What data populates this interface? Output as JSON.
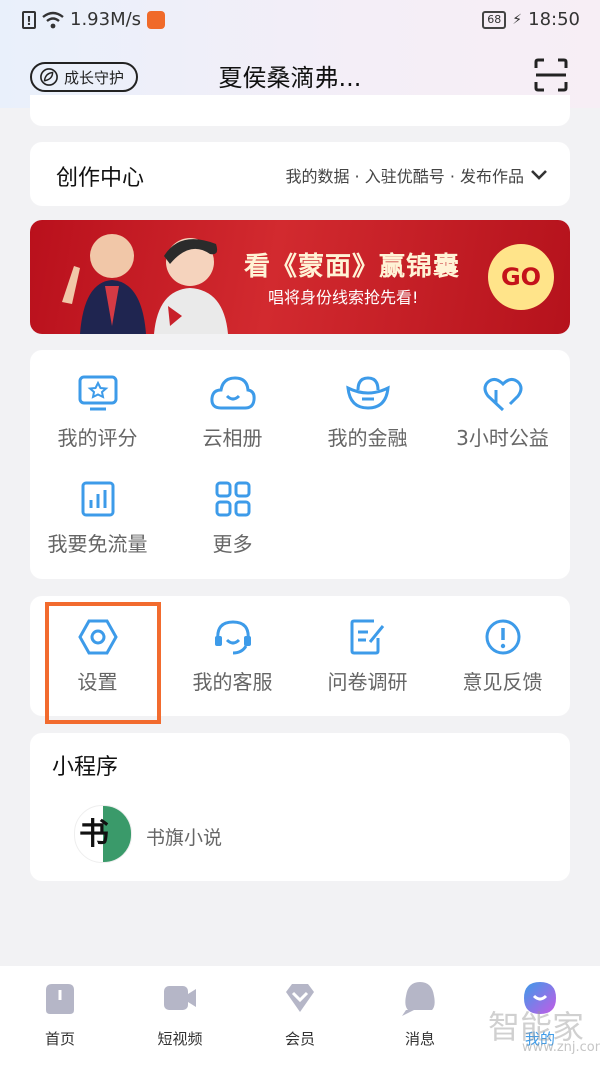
{
  "status_bar": {
    "speed": "1.93M/s",
    "battery": "68",
    "time": "18:50"
  },
  "header": {
    "guard_label": "成长守护",
    "title": "夏侯桑滴弗..."
  },
  "creation": {
    "label": "创作中心",
    "links": "我的数据 · 入驻优酷号 · 发布作品"
  },
  "banner": {
    "headline": "看《蒙面》赢锦囊",
    "sub": "唱将身份线索抢先看!",
    "go": "GO"
  },
  "services": [
    {
      "label": "我的评分",
      "icon": "rating-icon"
    },
    {
      "label": "云相册",
      "icon": "cloud-icon"
    },
    {
      "label": "我的金融",
      "icon": "ingot-icon"
    },
    {
      "label": "3小时公益",
      "icon": "charity-icon"
    },
    {
      "label": "我要免流量",
      "icon": "data-chart-icon"
    },
    {
      "label": "更多",
      "icon": "grid-icon"
    }
  ],
  "tools": [
    {
      "label": "设置",
      "icon": "settings-icon"
    },
    {
      "label": "我的客服",
      "icon": "customer-service-icon"
    },
    {
      "label": "问卷调研",
      "icon": "survey-icon"
    },
    {
      "label": "意见反馈",
      "icon": "feedback-icon"
    }
  ],
  "mini_programs": {
    "label": "小程序",
    "items": [
      {
        "name": "书旗小说",
        "logo_text": "书"
      }
    ]
  },
  "tabs": [
    {
      "label": "首页",
      "icon": "home-icon"
    },
    {
      "label": "短视频",
      "icon": "video-icon"
    },
    {
      "label": "会员",
      "icon": "vip-icon"
    },
    {
      "label": "消息",
      "icon": "message-icon"
    },
    {
      "label": "我的",
      "icon": "profile-icon",
      "active": true
    }
  ],
  "watermark": {
    "main": "智能家",
    "site": "www.znj.com"
  },
  "colors": {
    "accent": "#3d9be9",
    "highlight_box": "#f26b2e",
    "banner": "#c41b22"
  }
}
